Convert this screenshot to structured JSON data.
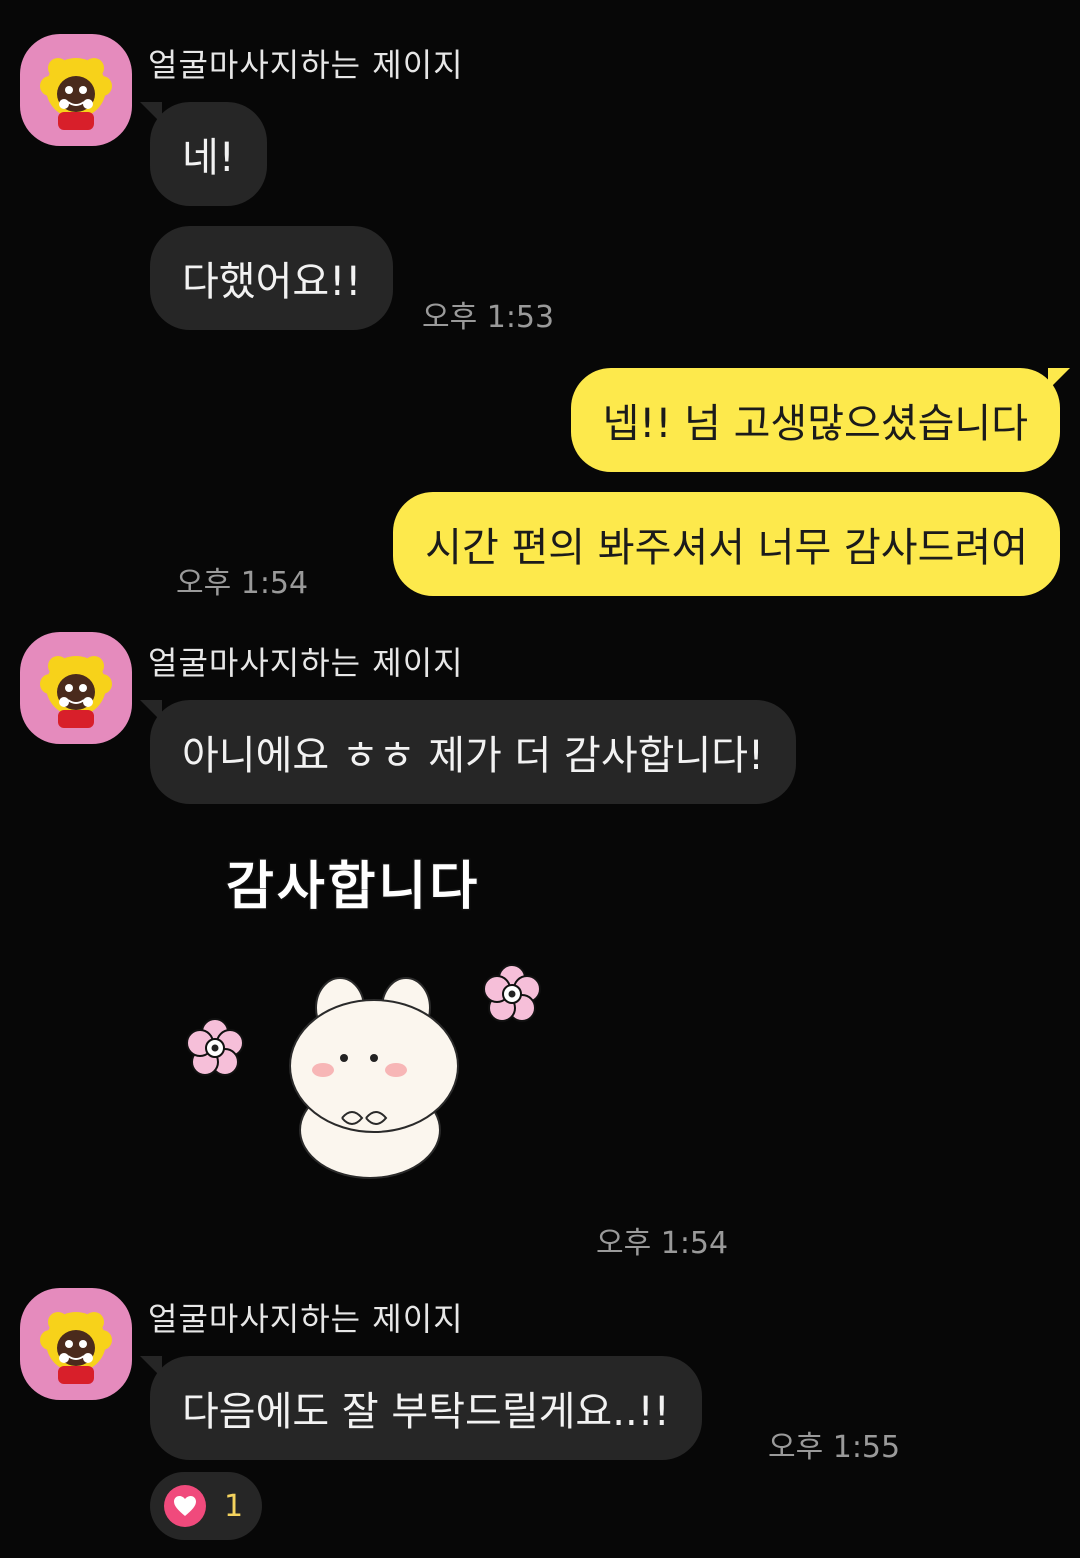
{
  "sender_name": "얼굴마사지하는 제이지",
  "messages": {
    "m1": "네!",
    "m2": "다했어요!!",
    "t1": "오후 1:53",
    "m3": "넵!! 넘 고생많으셨습니다",
    "m4": "시간 편의 봐주셔서 너무 감사드려여",
    "t2": "오후 1:54",
    "m5": "아니에요 ㅎㅎ 제가 더 감사합니다!",
    "sticker_text": "감사합니다",
    "t3": "오후 1:54",
    "m6": "다음에도 잘 부탁드릴게요..!!",
    "t4": "오후 1:55"
  },
  "reaction": {
    "icon": "heart-icon",
    "count": "1"
  },
  "colors": {
    "background": "#070707",
    "incoming_bubble": "#262626",
    "outgoing_bubble": "#fde94c",
    "avatar_bg": "#e58bbd",
    "heart": "#f04a7c"
  }
}
